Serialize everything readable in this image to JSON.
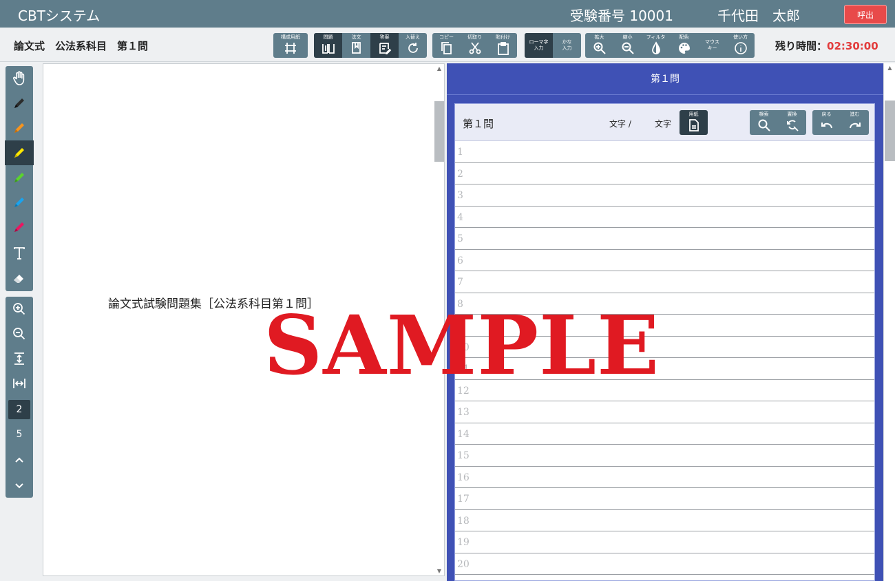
{
  "topbar": {
    "app_title": "CBTシステム",
    "exam_number": "受験番号 10001",
    "candidate_name": "千代田　太郎",
    "call_button": "呼出"
  },
  "subject": "論文式　公法系科目　第１問",
  "remaining": {
    "label": "残り時間：",
    "time": "02:30:00"
  },
  "toolbar": {
    "layout_paper": "構成用紙",
    "problem": "問題",
    "statutes": "法文",
    "answer": "答案",
    "swap": "入替え",
    "copy": "コピー",
    "cut": "切取り",
    "paste": "貼付け",
    "romaji_input": [
      "ローマ字",
      "入力"
    ],
    "kana_input": [
      "かな",
      "入力"
    ],
    "zoom_in": "拡大",
    "zoom_out": "縮小",
    "filter": "フィルタ",
    "color_scheme": "配色",
    "mouse_key": [
      "マウス",
      "キー"
    ],
    "help": "使い方"
  },
  "left_tools": {
    "current_page": "2",
    "total_pages": "5"
  },
  "document": {
    "heading": "論文式試験問題集［公法系科目第１問］"
  },
  "answer": {
    "header": "第１問",
    "sheet_title": "第１問",
    "char_count": "文字 /",
    "char_unit": "文字",
    "paper": "用紙",
    "search": "検索",
    "replace": "置換",
    "undo": "戻る",
    "redo": "進む",
    "line_numbers": [
      "1",
      "2",
      "3",
      "4",
      "5",
      "6",
      "7",
      "8",
      "9",
      "10",
      "11",
      "12",
      "13",
      "14",
      "15",
      "16",
      "17",
      "18",
      "19",
      "20"
    ]
  },
  "watermark": "SAMPLE",
  "colors": {
    "chrome": "#5f7d8b",
    "active": "#2e3f49",
    "answer_panel": "#3f51b5",
    "timer": "#e23b3b",
    "call_button": "#e84a4a",
    "watermark": "#e01a22"
  }
}
